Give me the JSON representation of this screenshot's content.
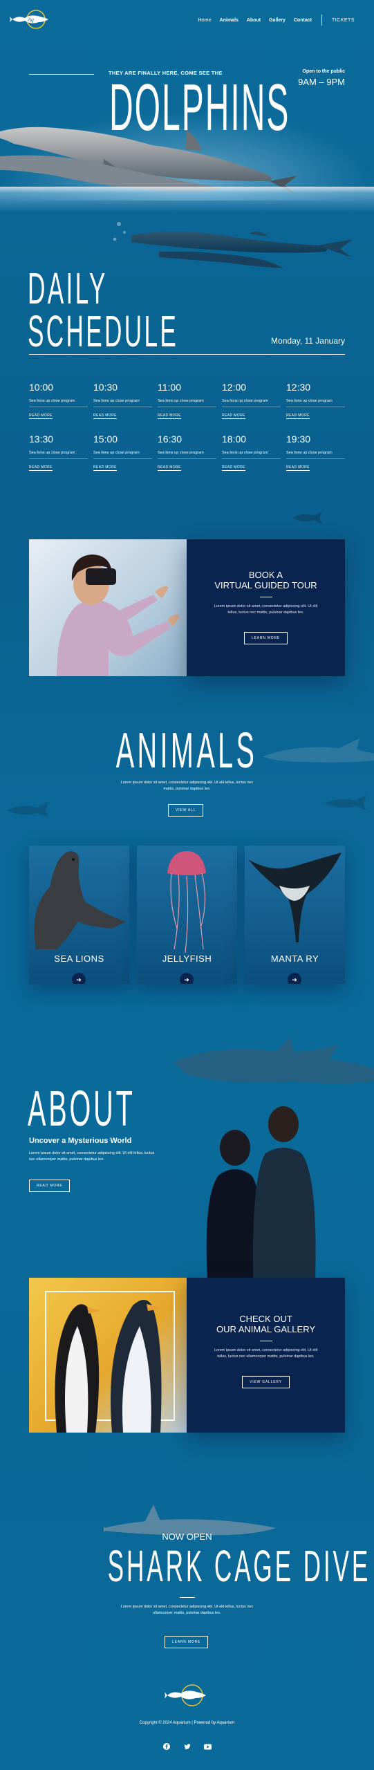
{
  "nav": {
    "items": [
      "Home",
      "Animals",
      "About",
      "Gallery",
      "Contact"
    ],
    "tickets": "TICKETS"
  },
  "hero": {
    "kicker": "THEY ARE FINALLY HERE, COME SEE THE",
    "title": "DOLPHINS",
    "open_label": "Open to the public",
    "hours": "9AM – 9PM"
  },
  "schedule": {
    "title_line1": "DAILY",
    "title_line2": "SCHEDULE",
    "date": "Monday, 11 January",
    "slots": [
      {
        "time": "10:00",
        "desc": "Sea lions up close program",
        "link": "READ MORE"
      },
      {
        "time": "10:30",
        "desc": "Sea lions up close program",
        "link": "READ MORE"
      },
      {
        "time": "11:00",
        "desc": "Sea lions up close program",
        "link": "READ MORE"
      },
      {
        "time": "12:00",
        "desc": "Sea lions up close program",
        "link": "READ MORE"
      },
      {
        "time": "12:30",
        "desc": "Sea lions up close program",
        "link": "READ MORE"
      },
      {
        "time": "13:30",
        "desc": "Sea lions up close program",
        "link": "READ MORE"
      },
      {
        "time": "15:00",
        "desc": "Sea lions up close program",
        "link": "READ MORE"
      },
      {
        "time": "16:30",
        "desc": "Sea lions up close program",
        "link": "READ MORE"
      },
      {
        "time": "18:00",
        "desc": "Sea lions up close program",
        "link": "READ MORE"
      },
      {
        "time": "19:30",
        "desc": "Sea lions up close program",
        "link": "READ MORE"
      }
    ]
  },
  "tour": {
    "title_line1": "BOOK A",
    "title_line2": "VIRTUAL GUIDED TOUR",
    "text": "Lorem ipsum dolor sit amet, consectetur adipiscing elit. Ut elit tellus, luctus nec mattis, pulvinar dapibus leo.",
    "button": "LEARN MORE"
  },
  "animals": {
    "title": "ANIMALS",
    "text": "Lorem ipsum dolor sit amet, consectetur adipiscing elit. Ut elit tellus, luctus nec mattis, pulvinar dapibus leo.",
    "button": "VIEW ALL",
    "cards": [
      {
        "name": "SEA LIONS"
      },
      {
        "name": "JELLYFISH"
      },
      {
        "name": "MANTA RY"
      }
    ]
  },
  "about": {
    "title": "ABOUT",
    "subtitle": "Uncover a Mysterious World",
    "text": "Lorem ipsum dolor sit amet, consectetur adipiscing elit. Ut elit tellus, luctus nec ullamcorper mattis, pulvinar dapibus leo.",
    "button": "READ MORE"
  },
  "gallery": {
    "title_line1": "CHECK OUT",
    "title_line2": "OUR ANIMAL GALLERY",
    "text": "Lorem ipsum dolor sit amet, consectetur adipiscing elit. Ut elit tellus, luctus nec ullamcorper mattis, pulvinar dapibus leo.",
    "button": "VIEW GALLERY"
  },
  "shark": {
    "kicker": "NOW OPEN",
    "title": "SHARK CAGE DIVE",
    "text": "Lorem ipsum dolor sit amet, consectetur adipiscing elit. Ut elit tellus, luctus nec ullamcorper mattis, pulvinar dapibus leo.",
    "button": "LEARN MORE"
  },
  "footer": {
    "copyright": "Copyright © 2024 Aquarium | Powered by Aquarium",
    "socials": [
      "facebook-icon",
      "twitter-icon",
      "youtube-icon"
    ]
  },
  "colors": {
    "ocean": "#0a6a9a",
    "navy": "#0a2450",
    "logo_ring": "#e8c23a"
  }
}
